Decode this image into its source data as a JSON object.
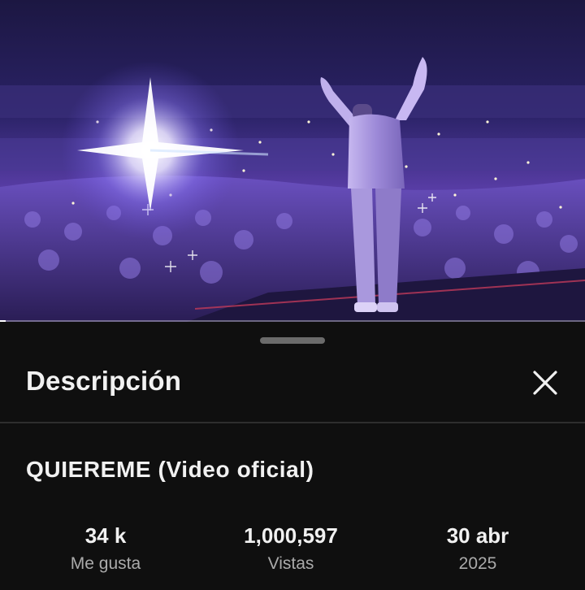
{
  "video": {
    "thumbnail_description": "",
    "progress_fraction": 0.01
  },
  "sheet": {
    "title": "Descripción",
    "close_icon": "close-icon"
  },
  "details": {
    "video_title": "QUIEREME (Video oficial)",
    "stats": [
      {
        "value": "34 k",
        "label": "Me gusta"
      },
      {
        "value": "1,000,597",
        "label": "Vistas"
      },
      {
        "value": "30 abr",
        "label": "2025"
      }
    ]
  },
  "colors": {
    "background": "#0f0f0f",
    "text_primary": "#f1f1f1",
    "text_secondary": "#aaaaaa",
    "divider": "#2e2e2e",
    "video_tint": "#5b3fb0"
  }
}
